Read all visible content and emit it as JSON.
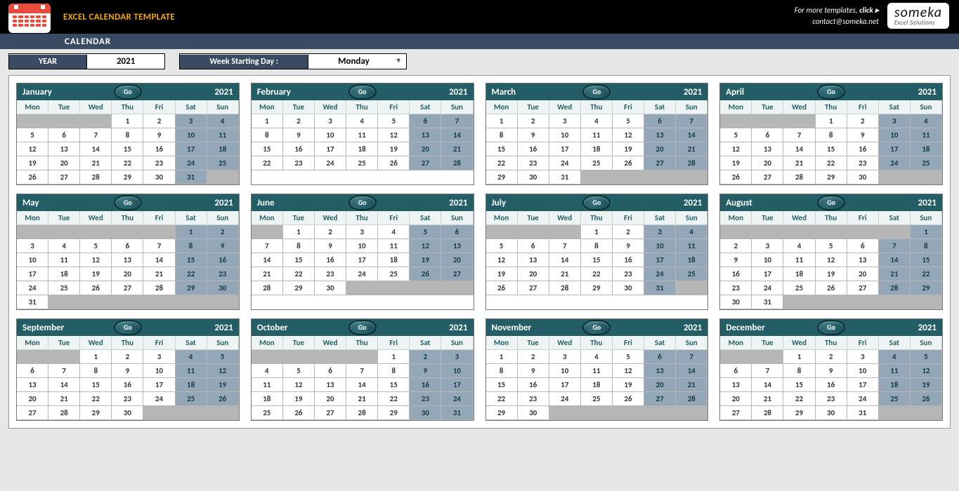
{
  "header": {
    "title": "EXCEL CALENDAR TEMPLATE",
    "subtitle": "CALENDAR",
    "more_templates": "For more templates, ",
    "click": "click ▸",
    "contact": "contact@someka.net",
    "logo_top": "someka",
    "logo_bottom": "Excel Solutions"
  },
  "controls": {
    "year_label": "YEAR",
    "year_value": "2021",
    "week_label": "Week Starting Day :",
    "week_value": "Monday"
  },
  "day_labels": [
    "Mon",
    "Tue",
    "Wed",
    "Thu",
    "Fri",
    "Sat",
    "Sun"
  ],
  "go_label": "Go",
  "months": [
    {
      "name": "January",
      "year": "2021",
      "start": 3,
      "days": 31
    },
    {
      "name": "February",
      "year": "2021",
      "start": 0,
      "days": 28
    },
    {
      "name": "March",
      "year": "2021",
      "start": 0,
      "days": 31
    },
    {
      "name": "April",
      "year": "2021",
      "start": 3,
      "days": 30
    },
    {
      "name": "May",
      "year": "2021",
      "start": 5,
      "days": 31
    },
    {
      "name": "June",
      "year": "2021",
      "start": 1,
      "days": 30
    },
    {
      "name": "July",
      "year": "2021",
      "start": 3,
      "days": 31
    },
    {
      "name": "August",
      "year": "2021",
      "start": 6,
      "days": 31
    },
    {
      "name": "September",
      "year": "2021",
      "start": 2,
      "days": 30
    },
    {
      "name": "October",
      "year": "2021",
      "start": 4,
      "days": 31
    },
    {
      "name": "November",
      "year": "2021",
      "start": 0,
      "days": 30
    },
    {
      "name": "December",
      "year": "2021",
      "start": 2,
      "days": 31
    }
  ]
}
